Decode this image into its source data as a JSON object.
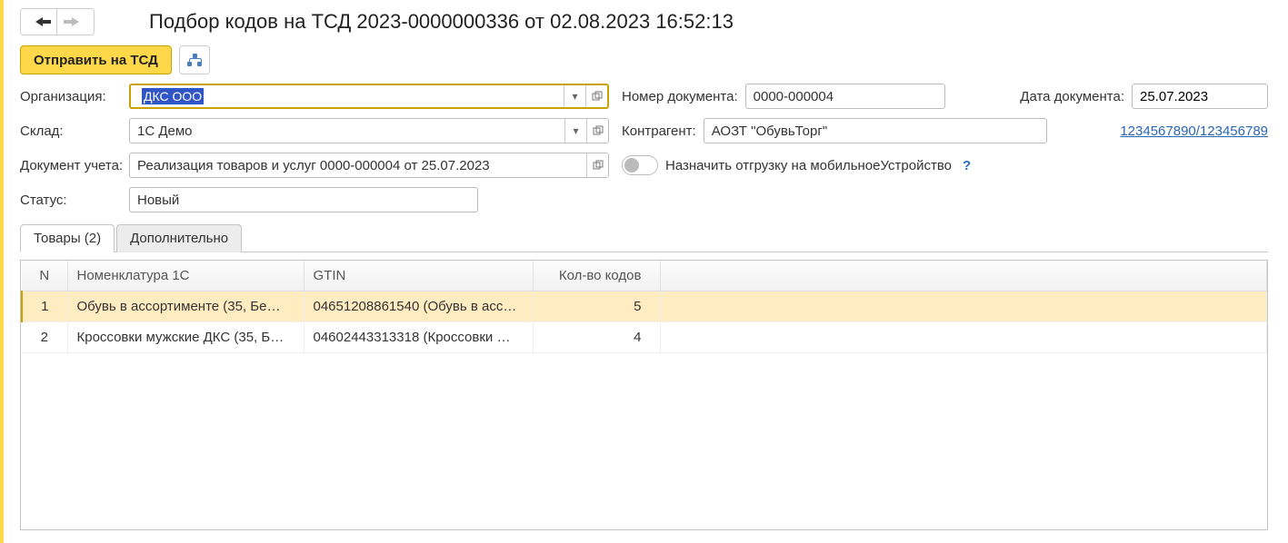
{
  "header": {
    "title": "Подбор кодов на ТСД 2023-0000000336 от 02.08.2023 16:52:13"
  },
  "toolbar": {
    "send_label": "Отправить на ТСД"
  },
  "form": {
    "org_label": "Организация:",
    "org_value": "ДКС ООО",
    "warehouse_label": "Склад:",
    "warehouse_value": "1С Демо",
    "docnum_label": "Номер документа:",
    "docnum_value": "0000-000004",
    "docdate_label": "Дата документа:",
    "docdate_value": "25.07.2023",
    "counterparty_label": "Контрагент:",
    "counterparty_value": "АОЗТ \"ОбувьТорг\"",
    "counterparty_link": "1234567890/123456789",
    "accdoc_label": "Документ учета:",
    "accdoc_value": "Реализация товаров и услуг 0000-000004 от 25.07.2023",
    "assign_label": "Назначить отгрузку на мобильноеУстройство",
    "status_label": "Статус:",
    "status_value": "Новый"
  },
  "tabs": {
    "goods": "Товары (2)",
    "extra": "Дополнительно"
  },
  "table": {
    "columns": {
      "n": "N",
      "nom": "Номенклатура 1С",
      "gtin": "GTIN",
      "qty": "Кол-во кодов"
    },
    "rows": [
      {
        "n": "1",
        "nom": "Обувь в ассортименте (35, Бе…",
        "gtin": "04651208861540 (Обувь в асс…",
        "qty": "5"
      },
      {
        "n": "2",
        "nom": "Кроссовки мужские ДКС (35, Б…",
        "gtin": "04602443313318 (Кроссовки …",
        "qty": "4"
      }
    ]
  },
  "icons": {
    "dropdown": "▾",
    "open": "▫",
    "calendar": "🗓",
    "help": "?"
  }
}
